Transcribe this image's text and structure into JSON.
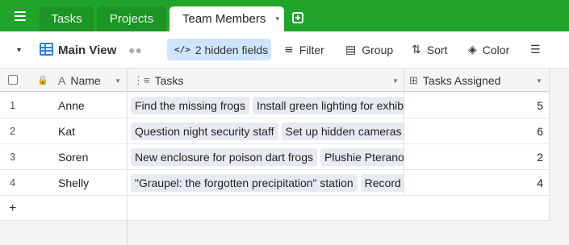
{
  "tabs": {
    "items": [
      {
        "label": "Tasks"
      },
      {
        "label": "Projects"
      },
      {
        "label": "Team Members"
      }
    ],
    "active_caret": "▾"
  },
  "toolbar": {
    "view_caret": "▾",
    "view_name": "Main View",
    "hidden_fields": "2 hidden fields",
    "filter": "Filter",
    "group": "Group",
    "sort": "Sort",
    "color": "Color"
  },
  "columns": {
    "name": "Name",
    "tasks": "Tasks",
    "tasks_assigned": "Tasks Assigned"
  },
  "rows": [
    {
      "num": "1",
      "name": "Anne",
      "tasks": [
        "Find the missing frogs",
        "Install green lighting for exhibit"
      ],
      "count": "5"
    },
    {
      "num": "2",
      "name": "Kat",
      "tasks": [
        "Question night security staff",
        "Set up hidden cameras",
        ""
      ],
      "count": "6"
    },
    {
      "num": "3",
      "name": "Soren",
      "tasks": [
        "New enclosure for poison dart frogs",
        "Plushie Pteranodon"
      ],
      "count": "2"
    },
    {
      "num": "4",
      "name": "Shelly",
      "tasks": [
        "\"Graupel: the forgotten precipitation\" station",
        "Record v"
      ],
      "count": "4"
    }
  ],
  "add_row": "+",
  "colors": {
    "brand_green": "#20a52a",
    "accent_blue": "#2d7ff9",
    "hidden_fields_bg": "#cfe5ff"
  },
  "icons": [
    "menu-icon",
    "grid-view-icon",
    "people-icon",
    "eye-slash-icon",
    "filter-icon",
    "group-icon",
    "sort-icon",
    "paint-bucket-icon",
    "row-height-icon"
  ]
}
